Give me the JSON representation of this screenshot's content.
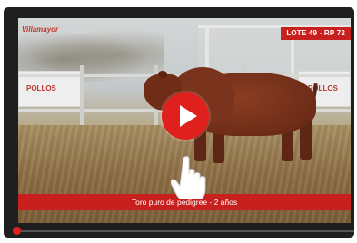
{
  "video": {
    "logo_text": "Villamayor",
    "lot_badge": "LOTE 49 - RP 72",
    "caption": "Toro puro de pedigree - 2 años",
    "banner_left": "POLLOS",
    "banner_right": "POLLOS"
  },
  "controls": {
    "play_icon": "play-icon",
    "progress_fraction": 0.0
  },
  "colors": {
    "accent_red": "#c8201e",
    "play_red": "#e0201c",
    "player_bg": "#1f1f1f"
  }
}
